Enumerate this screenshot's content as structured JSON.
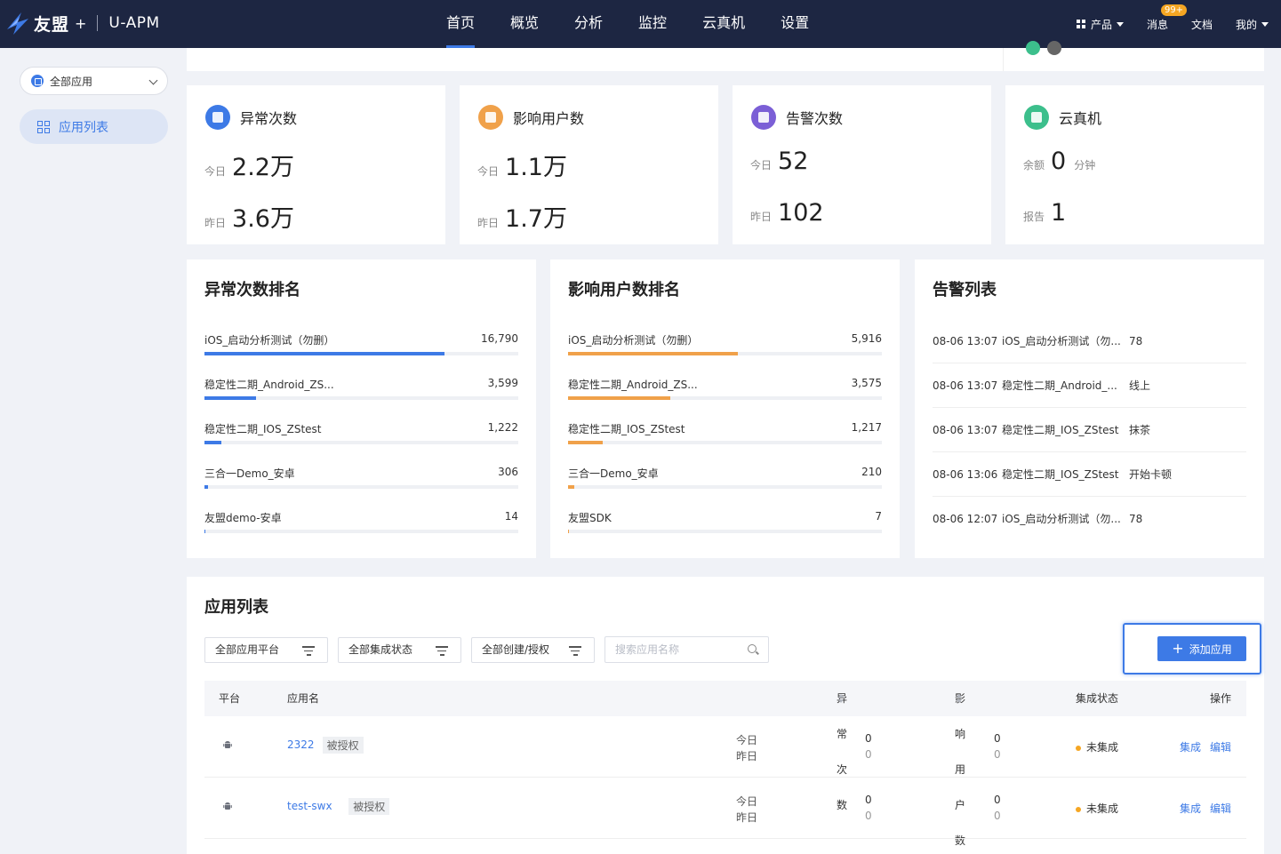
{
  "nav": {
    "brand": "友盟",
    "brand_plus": "+",
    "product": "U-APM",
    "items": [
      "首页",
      "概览",
      "分析",
      "监控",
      "云真机",
      "设置"
    ],
    "active_index": 0,
    "right": {
      "products": "产品",
      "messages": "消息",
      "messages_badge": "99+",
      "docs": "文档",
      "mine": "我的"
    }
  },
  "sidebar": {
    "app_select": "全部应用",
    "items": [
      {
        "label": "应用列表",
        "active": true
      }
    ]
  },
  "stats": [
    {
      "title": "异常次数",
      "icon": "exception-icon",
      "color": "#3d7ae6",
      "rows": [
        {
          "label": "今日",
          "value": "2.2万"
        },
        {
          "label": "昨日",
          "value": "3.6万"
        }
      ]
    },
    {
      "title": "影响用户数",
      "icon": "users-icon",
      "color": "#f0a14a",
      "rows": [
        {
          "label": "今日",
          "value": "1.1万"
        },
        {
          "label": "昨日",
          "value": "1.7万"
        }
      ]
    },
    {
      "title": "告警次数",
      "icon": "alarm-icon",
      "color": "#7b5fd6",
      "rows": [
        {
          "label": "今日",
          "value": "52"
        },
        {
          "label": "昨日",
          "value": "102"
        }
      ]
    },
    {
      "title": "云真机",
      "icon": "phone-icon",
      "color": "#3cbf8c",
      "rows": [
        {
          "label": "余额",
          "value": "0",
          "unit": "分钟"
        },
        {
          "label": "报告",
          "value": "1"
        }
      ]
    }
  ],
  "exception_rank": {
    "title": "异常次数排名",
    "color": "#3d7ae6",
    "items": [
      {
        "name": "iOS_启动分析测试（勿删）",
        "value": "16,790",
        "ratio": 0.765
      },
      {
        "name": "稳定性二期_Android_ZS...",
        "value": "3,599",
        "ratio": 0.163
      },
      {
        "name": "稳定性二期_IOS_ZStest",
        "value": "1,222",
        "ratio": 0.055
      },
      {
        "name": "三合一Demo_安卓",
        "value": "306",
        "ratio": 0.012
      },
      {
        "name": "友盟demo-安卓",
        "value": "14",
        "ratio": 0.004
      }
    ]
  },
  "user_rank": {
    "title": "影响用户数排名",
    "color": "#f0a14a",
    "items": [
      {
        "name": "iOS_启动分析测试（勿删）",
        "value": "5,916",
        "ratio": 0.54
      },
      {
        "name": "稳定性二期_Android_ZS...",
        "value": "3,575",
        "ratio": 0.325
      },
      {
        "name": "稳定性二期_IOS_ZStest",
        "value": "1,217",
        "ratio": 0.11
      },
      {
        "name": "三合一Demo_安卓",
        "value": "210",
        "ratio": 0.02
      },
      {
        "name": "友盟SDK",
        "value": "7",
        "ratio": 0.003
      }
    ]
  },
  "alerts": {
    "title": "告警列表",
    "items": [
      {
        "time": "08-06 13:07",
        "app": "iOS_启动分析测试（勿...",
        "msg": "78"
      },
      {
        "time": "08-06 13:07",
        "app": "稳定性二期_Android_...",
        "msg": "线上"
      },
      {
        "time": "08-06 13:07",
        "app": "稳定性二期_IOS_ZStest",
        "msg": "抹茶"
      },
      {
        "time": "08-06 13:06",
        "app": "稳定性二期_IOS_ZStest",
        "msg": "开始卡顿"
      },
      {
        "time": "08-06 12:07",
        "app": "iOS_启动分析测试（勿...",
        "msg": "78"
      }
    ]
  },
  "app_list": {
    "title": "应用列表",
    "filters": [
      "全部应用平台",
      "全部集成状态",
      "全部创建/授权"
    ],
    "search_placeholder": "搜索应用名称",
    "add_button": "添加应用",
    "columns": {
      "platform": "平台",
      "name": "应用名",
      "exceptions": "异常次数",
      "users": "影响用户数",
      "status": "集成状态",
      "ops": "操作"
    },
    "day_labels": {
      "today": "今日",
      "yesterday": "昨日"
    },
    "rows": [
      {
        "platform": "android-icon",
        "name": "2322",
        "tag": "被授权",
        "exc_today": "0",
        "exc_yesterday": "0",
        "users_today": "0",
        "users_yesterday": "0",
        "status": "未集成",
        "actions": [
          "集成",
          "编辑"
        ]
      },
      {
        "platform": "android-icon",
        "name": "test-swx",
        "tag": "被授权",
        "exc_today": "0",
        "exc_yesterday": "0",
        "users_today": "0",
        "users_yesterday": "0",
        "status": "未集成",
        "actions": [
          "集成",
          "编辑"
        ]
      }
    ]
  }
}
